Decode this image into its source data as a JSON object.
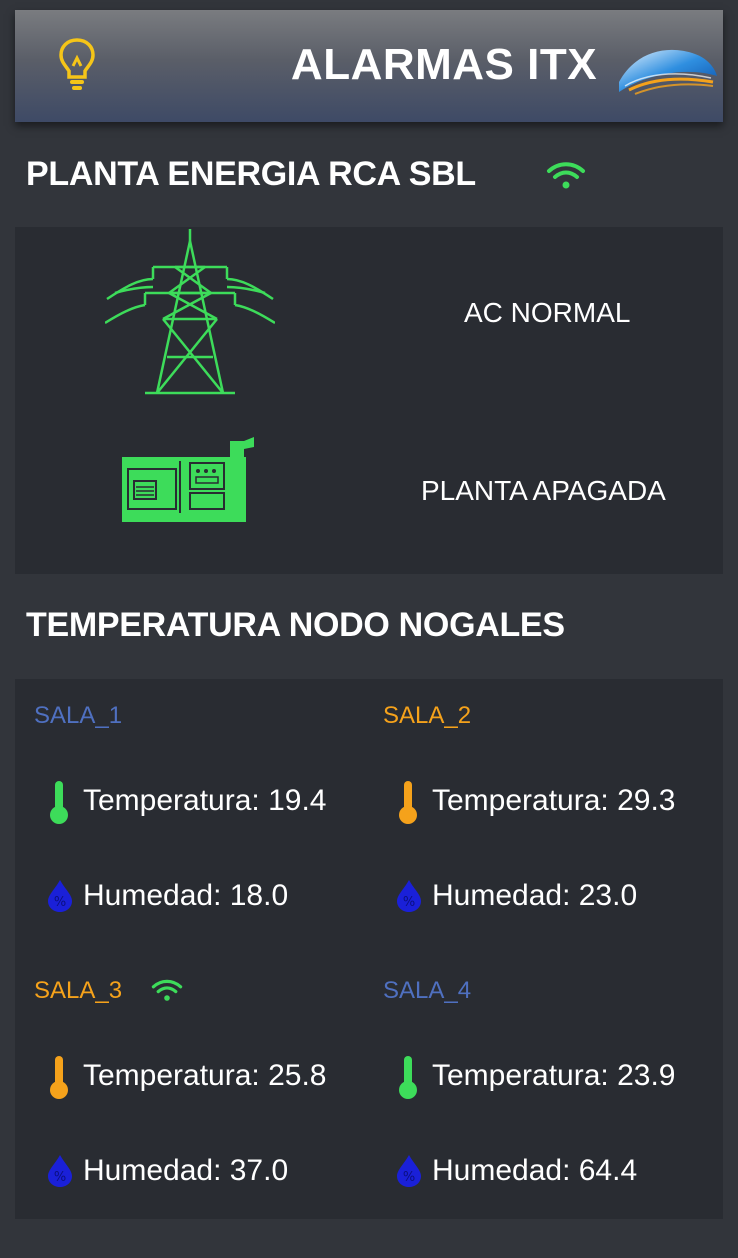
{
  "header": {
    "title": "ALARMAS ITX",
    "bulb_icon": "lightbulb-icon",
    "logo": "company-logo"
  },
  "planta": {
    "title": "PLANTA ENERGIA RCA SBL",
    "ac_status": "AC NORMAL",
    "generator_status": "PLANTA APAGADA"
  },
  "temperatura": {
    "title": "TEMPERATURA NODO NOGALES",
    "salas": [
      {
        "name": "SALA_1",
        "temp": "Temperatura: 19.4",
        "hum": "Humedad: 18.0",
        "name_color": "#4f70c0",
        "therm_color": "#3ddc5a"
      },
      {
        "name": "SALA_2",
        "temp": "Temperatura: 29.3",
        "hum": "Humedad: 23.0",
        "name_color": "#f5a21b",
        "therm_color": "#f5a21b"
      },
      {
        "name": "SALA_3",
        "temp": "Temperatura: 25.8",
        "hum": "Humedad: 37.0",
        "name_color": "#f5a21b",
        "therm_color": "#f5a21b"
      },
      {
        "name": "SALA_4",
        "temp": "Temperatura: 23.9",
        "hum": "Humedad: 64.4",
        "name_color": "#4f70c0",
        "therm_color": "#3ddc5a"
      }
    ]
  },
  "colors": {
    "green": "#3ddc5a",
    "orange": "#f5a21b",
    "blue": "#4f70c0",
    "drop": "#1a20d8",
    "card": "#292c32",
    "background": "#32353b"
  }
}
